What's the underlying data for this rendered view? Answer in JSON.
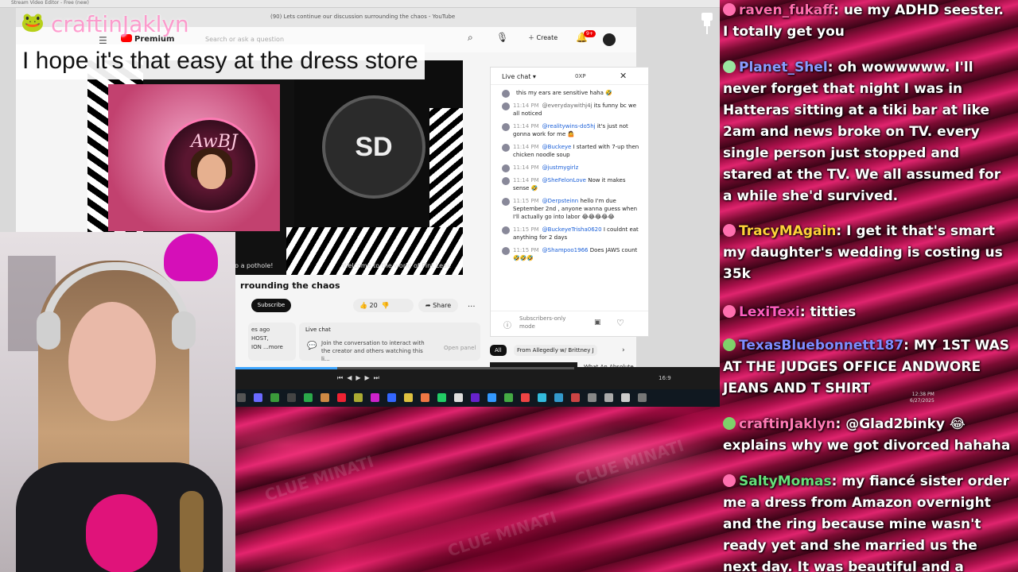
{
  "screen": {
    "window_title": "Stream Video Editor - Free (new)",
    "tab_title": "(90) Lets continue our discussion surrounding the chaos - YouTube",
    "youtube": {
      "logo_text": "Premium",
      "search_placeholder": "Search or ask a question",
      "create_label": "Create",
      "notification_count": "9+",
      "video": {
        "awbj_text": "AwBJ",
        "sd_text": "SD",
        "caption_left": "fall into a pothole!",
        "caption_right": "Welcome to the world of Pint Leak",
        "title": "rrounding the chaos",
        "subscribe_label": "Subscribe",
        "like_count": "20",
        "share_label": "Share",
        "more_label": "...",
        "desc_line1": "es ago",
        "desc_line2": "HOST,",
        "desc_line3": "ION  ...more"
      },
      "live_chat_card": {
        "title": "Live chat",
        "text": "Join the conversation to interact with the creator and others watching this li...",
        "open_label": "Open panel"
      },
      "chat_panel": {
        "title": "Live chat",
        "xp_label": "0XP",
        "messages": [
          {
            "time": "",
            "user": "",
            "text": "this my ears are sensitive haha 🤣"
          },
          {
            "time": "11:14 PM",
            "user": "@everydaywithj4j",
            "text": "its funny bc we all noticed"
          },
          {
            "time": "11:14 PM",
            "user": "@realitywins-do5hj",
            "text": "it's just not gonna work for me 🤷"
          },
          {
            "time": "11:14 PM",
            "user": "@Buckeye",
            "text": "I started with 7-up then chicken noodle soup"
          },
          {
            "time": "11:14 PM",
            "user": "@justmygirlz",
            "text": ""
          },
          {
            "time": "11:14 PM",
            "user": "@SheFelonLove",
            "text": "Now it makes sense 🤣"
          },
          {
            "time": "11:15 PM",
            "user": "@Derpsteinn",
            "text": "hello I'm due September 2nd , anyone wanna guess when I'll actually go into labor 😂😂😂😂😂"
          },
          {
            "time": "11:15 PM",
            "user": "@BuckeyeTrisha0620",
            "text": "I couldnt eat anything for 2 days"
          },
          {
            "time": "11:15 PM",
            "user": "@Shampoo1966",
            "text": "Does JAWS count 🤣🤣🤣"
          }
        ],
        "subscribers_only": "Subscribers-only mode"
      },
      "chips": {
        "all": "All",
        "second": "From Allegedly w/ Brittney J"
      },
      "rec_title": "What An Absolute"
    },
    "media": {
      "ratio": "16:9",
      "progress": 0.3
    },
    "taskbar": {
      "time": "12:38 PM",
      "date": "6/27/2025"
    }
  },
  "overlay": {
    "streamer_name": "craftinJaklyn",
    "caption": "I hope it's that easy at the dress store"
  },
  "watermark_text": "CLUE MINATI",
  "chat": [
    {
      "name": "raven_fukaff",
      "color": "#ff6fae",
      "badge": "#ff6fae",
      "text": ": ue my ADHD seester. I totally get you"
    },
    {
      "name": "Planet_Shel",
      "color": "#8a9bff",
      "badge": "#9ae6a0",
      "text": ": oh wowwwww. I'll never forget that night I was in Hatteras sitting at a tiki bar at like 2am and news broke on TV. every single person just stopped and stared at the TV. We all assumed for a while she'd survived."
    },
    {
      "name": "TracyMAgain",
      "color": "#ffd23a",
      "badge": "#ff6fae",
      "text": ": I get it that's smart my daughter's wedding is costing us 35k"
    },
    {
      "name": "LexiTexi",
      "color": "#ff5ec0",
      "badge": "#ff6fae",
      "text": ": titties"
    },
    {
      "name": "TexasBluebonnett187",
      "color": "#7f8cff",
      "badge": "#7fd16a",
      "text": ": MY 1ST WAS AT THE JUDGES OFFICE ANDWORE JEANS AND T SHIRT"
    },
    {
      "name": "craftinJaklyn",
      "color": "#ff7ab4",
      "badge": "#7fd16a",
      "text": ": @Glad2binky 😂 explains why we got divorced hahaha"
    },
    {
      "name": "SaltyMomas",
      "color": "#66e07a",
      "badge": "#ff6fae",
      "text": ": my fiancé sister order me a dress from Amazon overnight and the ring because mine wasn't ready yet and she married us the next day. It was beautiful and a"
    }
  ]
}
